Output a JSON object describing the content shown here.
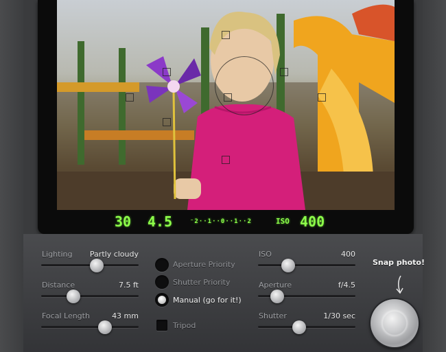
{
  "viewfinder": {
    "shutter_display": "30",
    "aperture_display": "4.5",
    "meter_display": "⁻2··1··0··1··2",
    "iso_label": "ISO",
    "iso_display": "400"
  },
  "controls": {
    "lighting": {
      "label": "Lighting",
      "value": "Partly cloudy",
      "level": 0.55
    },
    "distance": {
      "label": "Distance",
      "value": "7.5 ft",
      "level": 0.33
    },
    "focal_length": {
      "label": "Focal Length",
      "value": "43 mm",
      "level": 0.66
    },
    "iso": {
      "label": "ISO",
      "value": "400",
      "level": 0.31
    },
    "aperture": {
      "label": "Aperture",
      "value": "f/4.5",
      "level": 0.2
    },
    "shutter": {
      "label": "Shutter",
      "value": "1/30 sec",
      "level": 0.42
    }
  },
  "modes": [
    {
      "label": "Aperture Priority",
      "selected": false
    },
    {
      "label": "Shutter Priority",
      "selected": false
    },
    {
      "label": "Manual (go for it!)",
      "selected": true
    }
  ],
  "tripod": {
    "label": "Tripod",
    "checked": false
  },
  "snap": {
    "label": "Snap photo!"
  },
  "colors": {
    "lcd": "#8dff4a",
    "panel": "#3a3b3d"
  }
}
